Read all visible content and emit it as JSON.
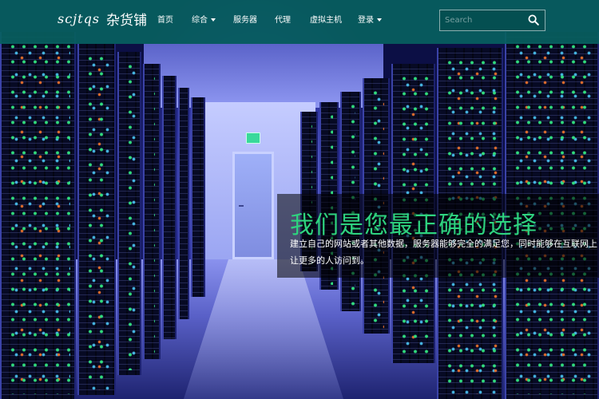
{
  "brand": {
    "latin": "scjtqs",
    "cn": "杂货铺"
  },
  "nav": {
    "home": "首页",
    "general": "综合",
    "servers": "服务器",
    "proxy": "代理",
    "vhost": "虚拟主机",
    "login": "登录"
  },
  "search": {
    "placeholder": "Search",
    "icon": "search-icon"
  },
  "hero": {
    "title": "我们是您最正确的选择",
    "text": "建立自己的网站或者其他数据，服务器能够完全的满足您，同时能够在互联网上让更多的人访问到。",
    "accent_color": "#2ed37f",
    "nav_color": "#086060"
  }
}
